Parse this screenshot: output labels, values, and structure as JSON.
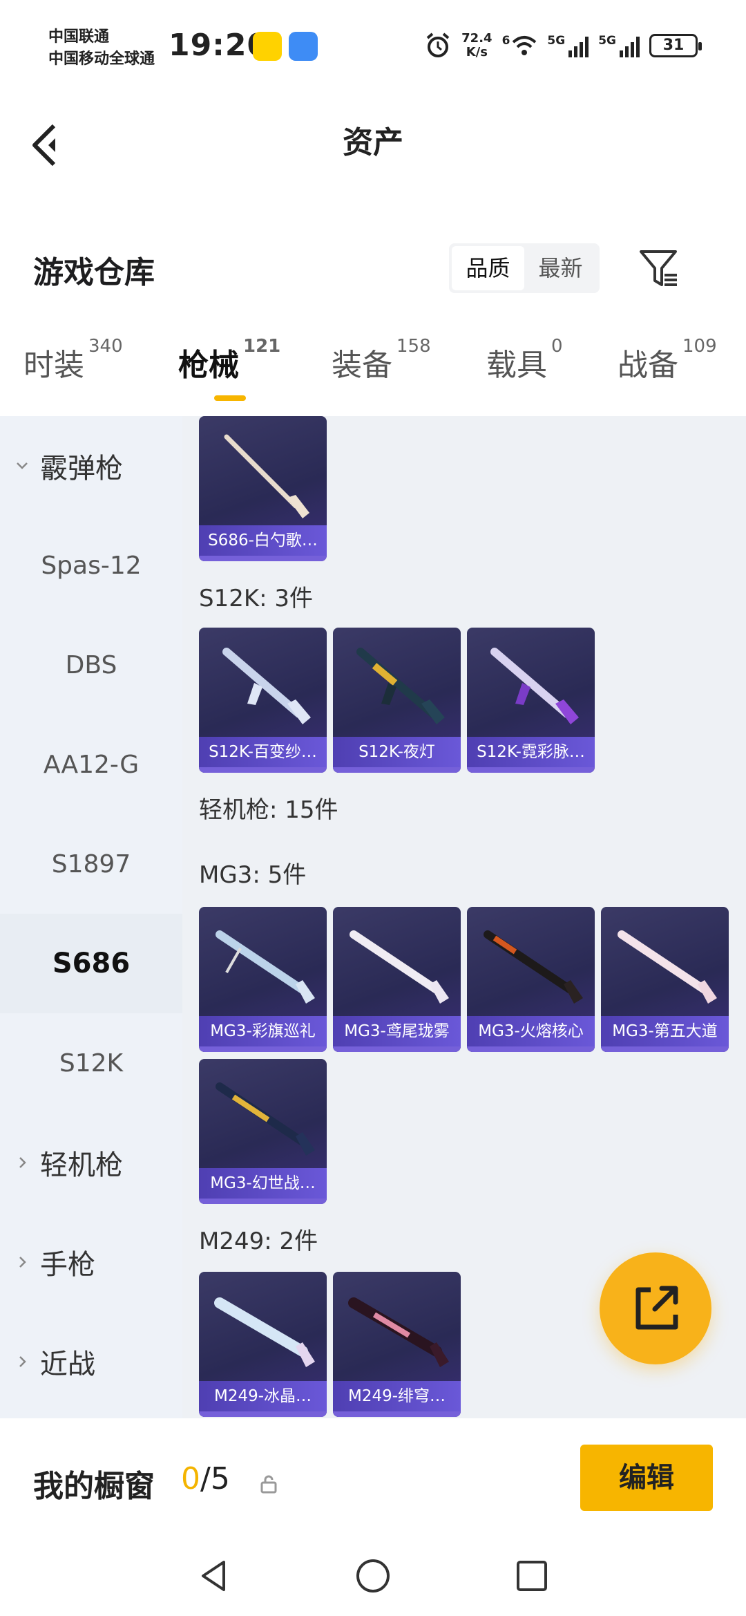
{
  "status_bar": {
    "carrier_1": "中国联通",
    "carrier_2": "中国移动全球通",
    "time": "19:20",
    "net_speed_value": "72.4",
    "net_speed_unit": "K/s",
    "wifi_badge": "6",
    "signal_1_label": "5G",
    "signal_2_label": "5G",
    "battery": "31"
  },
  "header": {
    "title": "资产",
    "back_icon": "chevron-left-icon"
  },
  "warehouse": {
    "title": "游戏仓库",
    "sort_options": [
      "品质",
      "最新"
    ],
    "active_sort": "品质",
    "filter_icon": "filter-icon"
  },
  "tabs": [
    {
      "label": "时装",
      "count": "340"
    },
    {
      "label": "枪械",
      "count": "121"
    },
    {
      "label": "装备",
      "count": "158"
    },
    {
      "label": "载具",
      "count": "0"
    },
    {
      "label": "战备",
      "count": "109"
    }
  ],
  "active_tab": "枪械",
  "sidebar": {
    "items": [
      {
        "label": "霰弹枪",
        "type": "group-expanded"
      },
      {
        "label": "Spas-12",
        "type": "sub"
      },
      {
        "label": "DBS",
        "type": "sub"
      },
      {
        "label": "AA12-G",
        "type": "sub"
      },
      {
        "label": "S1897",
        "type": "sub"
      },
      {
        "label": "S686",
        "type": "sub-active"
      },
      {
        "label": "S12K",
        "type": "sub"
      },
      {
        "label": "轻机枪",
        "type": "group-collapsed"
      },
      {
        "label": "手枪",
        "type": "group-collapsed"
      },
      {
        "label": "近战",
        "type": "group-collapsed"
      }
    ]
  },
  "content": {
    "s686_items": [
      {
        "name": "S686-白勺歌…"
      }
    ],
    "s12k_header": "S12K: 3件",
    "s12k_items": [
      {
        "name": "S12K-百变纱…"
      },
      {
        "name": "S12K-夜灯"
      },
      {
        "name": "S12K-霓彩脉…"
      }
    ],
    "lmg_header": "轻机枪: 15件",
    "mg3_header": "MG3: 5件",
    "mg3_items": [
      {
        "name": "MG3-彩旗巡礼"
      },
      {
        "name": "MG3-鸢尾珑雾"
      },
      {
        "name": "MG3-火熔核心"
      },
      {
        "name": "MG3-第五大道"
      },
      {
        "name": "MG3-幻世战…"
      }
    ],
    "m249_header": "M249: 2件",
    "m249_items": [
      {
        "name": "M249-冰晶…"
      },
      {
        "name": "M249-绯穹…"
      }
    ]
  },
  "share_button_icon": "share-external-icon",
  "showcase": {
    "title": "我的橱窗",
    "current": "0",
    "total": "/5",
    "lock_icon": "lock-icon",
    "edit_label": "编辑"
  },
  "nav": {
    "back_icon": "nav-back-icon",
    "home_icon": "nav-home-icon",
    "recents_icon": "nav-recents-icon"
  },
  "colors": {
    "accent": "#f7b500",
    "card_bg": "#2a2a55",
    "card_caption": "#5b49c8",
    "sidebar_bg": "#eef2f8"
  }
}
